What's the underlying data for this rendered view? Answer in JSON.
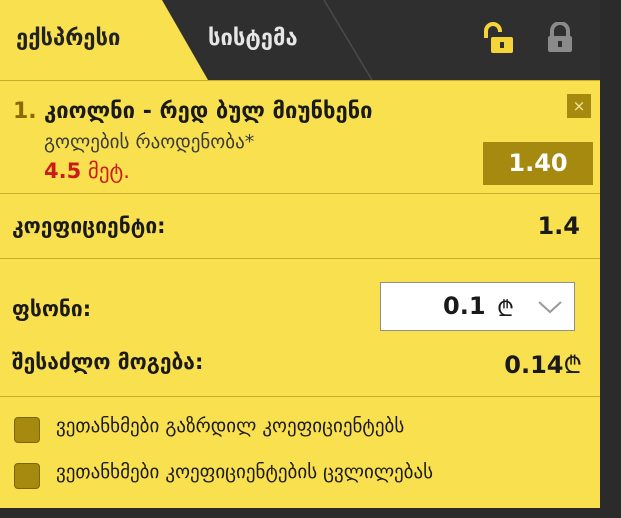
{
  "tabs": {
    "express_label": "ექსპრესი",
    "system_label": "სისტემა"
  },
  "icons": {
    "lock_open": "lock-open-icon",
    "lock_closed": "lock-closed-icon",
    "close": "close-icon",
    "chevron": "chevron-down-icon"
  },
  "bet": {
    "index": "1.",
    "match": "კიოლნი - რედ ბულ მიუნხენი",
    "market": "გოლების რაოდენობა*",
    "selection_value": "4.5",
    "selection_suffix": "მეტ.",
    "odds": "1.40",
    "remove_label": "×"
  },
  "summary": {
    "coefficient_label": "კოეფიციენტი:",
    "coefficient_value": "1.4",
    "stake_label": "ფსონი:",
    "stake_value": "0.1",
    "stake_currency": "₾",
    "winnings_label": "შესაძლო მოგება:",
    "winnings_value": "0.14",
    "winnings_currency": "₾"
  },
  "options": [
    {
      "label": "ვეთანხმები გაზრდილ კოეფიციენტებს",
      "checked": false
    },
    {
      "label": "ვეთანხმები კოეფიციენტების ცვლილებას",
      "checked": false
    }
  ],
  "colors": {
    "panel_bg": "#f9e04f",
    "tabbar_bg": "#2f2f2f",
    "accent_dark": "#a68a10",
    "selection_red": "#cc1b1b",
    "lock_open": "#f5d43a",
    "lock_closed": "#8a8a8a"
  }
}
